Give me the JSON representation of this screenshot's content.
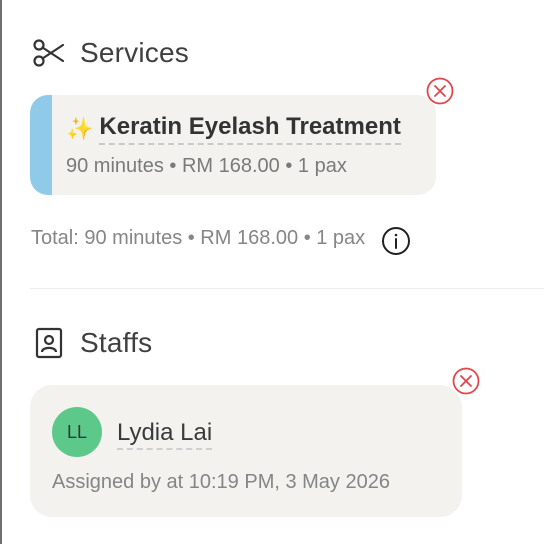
{
  "services_section": {
    "title": "Services",
    "icon": "scissors-icon",
    "items": [
      {
        "emoji": "✨",
        "name": "Keratin Eyelash Treatment",
        "meta": "90 minutes • RM 168.00 • 1 pax",
        "accent_color": "#8fcbe9"
      }
    ],
    "total": "Total: 90 minutes • RM 168.00 • 1 pax"
  },
  "staffs_section": {
    "title": "Staffs",
    "icon": "id-badge-icon",
    "items": [
      {
        "initials": "LL",
        "name": "Lydia Lai",
        "assigned": "Assigned by at 10:19 PM, 3 May 2026",
        "avatar_color": "#5cc98a"
      }
    ]
  },
  "colors": {
    "remove": "#e0474c",
    "card_bg": "#f3f2ee"
  }
}
